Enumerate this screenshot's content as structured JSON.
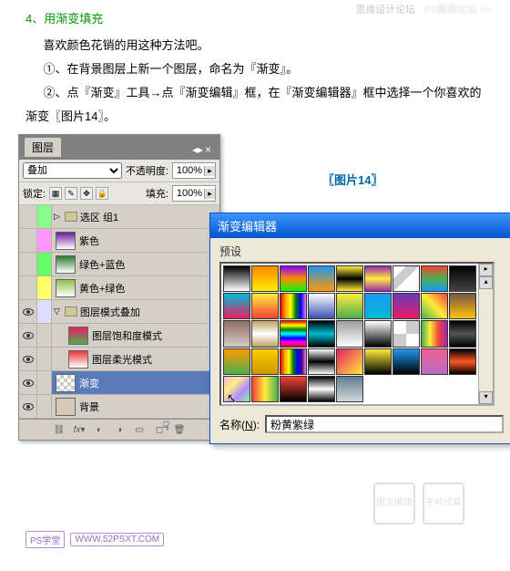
{
  "watermark_top": {
    "left": "思缘设计论坛",
    "right": "PS教程论坛 >>"
  },
  "step_title": "4、用渐变填充",
  "paragraphs": [
    "喜欢颜色花销的用这种方法吧。",
    "①、在背景图层上新一个图层，命名为『渐变』。",
    "②、点『渐变』工具→点『渐变编辑』框，在『渐变编辑器』框中选择一个你喜欢的渐变〖图片14〗。"
  ],
  "figure_label": "〖图片14〗",
  "layers_panel": {
    "title": "图层",
    "blend_mode": "叠加",
    "opacity_label": "不透明度:",
    "opacity_value": "100%",
    "lock_label": "锁定:",
    "fill_label": "填充:",
    "fill_value": "100%",
    "items": [
      {
        "type": "group",
        "label": "选区 组1",
        "color": "#88ff88"
      },
      {
        "type": "layer",
        "label": "紫色",
        "color": "#ff99ff",
        "thumb": "linear-gradient(#6a1b9a,#fff)"
      },
      {
        "type": "layer",
        "label": "绿色+蓝色",
        "color": "#66ff66",
        "thumb": "linear-gradient(#2e7d32,#fff)"
      },
      {
        "type": "layer",
        "label": "黄色+绿色",
        "color": "#ffff66",
        "thumb": "linear-gradient(#8bc34a,#fff)"
      },
      {
        "type": "group",
        "label": "图层模式叠加",
        "color": "#ddddff",
        "open": true
      },
      {
        "type": "layer",
        "label": "图层饱和度模式",
        "color": "",
        "thumb": "linear-gradient(#e91e63,#4caf50)",
        "indent": true
      },
      {
        "type": "layer",
        "label": "图层柔光模式",
        "color": "",
        "thumb": "linear-gradient(#e53935,#fff)",
        "indent": true
      },
      {
        "type": "layer",
        "label": "渐变",
        "color": "",
        "thumb": "repeating-conic-gradient(#ccc 0 25%, #fff 0 50%) 0 0/8px 8px",
        "selected": true
      },
      {
        "type": "layer",
        "label": "背景",
        "color": "",
        "thumb": "#d7c9b8"
      }
    ]
  },
  "gradient_editor": {
    "title": "渐变编辑器",
    "preset_label": "预设",
    "name_label": "名称",
    "name_key": "N",
    "name_value": "粉黄紫绿",
    "swatches": [
      "linear-gradient(#000,#fff)",
      "linear-gradient(#ff8800,#ffee00)",
      "linear-gradient(#8b00ff,#ff8c00,#00ff00)",
      "linear-gradient(#2196f3,#ff9800)",
      "linear-gradient(#ffeb3b,#000,#ffeb3b)",
      "linear-gradient(#9c27b0,#ffeb3b,#9c27b0)",
      "linear-gradient(135deg,#fff 25%,#ccc 25%,#ccc 50%,#fff 50%)",
      "linear-gradient(#f44336,#4caf50,#2196f3)",
      "linear-gradient(#000,#444)",
      "linear-gradient(#00bcd4,#e91e63)",
      "linear-gradient(#ffeb3b,#f44336)",
      "linear-gradient(90deg,red,orange,yellow,green,blue,violet)",
      "linear-gradient(#fff,#3f51b5)",
      "linear-gradient(#ffeb3b,#4caf50)",
      "linear-gradient(#2196f3,#00bcd4)",
      "linear-gradient(#673ab7,#e91e63)",
      "linear-gradient(45deg,#4caf50,#ffeb3b,#f44336)",
      "linear-gradient(#795548,#ffc107)",
      "linear-gradient(#8d6e63,#d7ccc8)",
      "linear-gradient(#c0a060,#fff,#c0a060)",
      "linear-gradient(red,yellow,green,cyan,blue,magenta,red)",
      "linear-gradient(#000,#00bcd4,#000)",
      "linear-gradient(#9e9e9e,#fff)",
      "linear-gradient(#fff,#000)",
      "repeating-conic-gradient(#ccc 0 25%, #fff 0 50%)",
      "linear-gradient(90deg,#4caf50,#ffeb3b,#f44336,#9c27b0)",
      "linear-gradient(#000,#555,#000)",
      "linear-gradient(#ff9800,#4caf50)",
      "linear-gradient(#ffcc00,#cc9900)",
      "linear-gradient(90deg,red,orange,yellow,green,blue,indigo,violet)",
      "linear-gradient(#fff,#000,#fff)",
      "linear-gradient(135deg,#e91e63,#ffeb3b)",
      "linear-gradient(#ffeb3b,#000)",
      "linear-gradient(#2196f3,#000)",
      "linear-gradient(#f06292,#ba68c8)",
      "linear-gradient(#000,#ff5722,#000)",
      "linear-gradient(135deg,#ffb3d9,#ffee88,#b388ff,#88ff88)",
      "linear-gradient(90deg,#f44336,#ffeb3b,#4caf50)",
      "linear-gradient(#f44336,#000)",
      "linear-gradient(#000,#fff,#000)",
      "linear-gradient(#607d8b,#cfd8dc)",
      "#333",
      "#333",
      "#333",
      "#333"
    ]
  },
  "seals": [
    "图文编辑",
    "平纯代真"
  ],
  "footer": {
    "tag1": "PS学堂",
    "tag2": "WWW.52PSXT.COM"
  }
}
